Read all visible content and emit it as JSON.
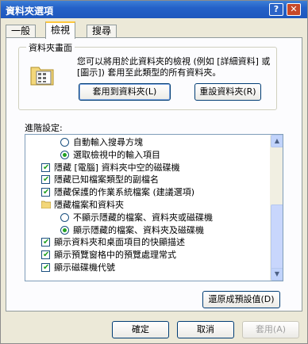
{
  "window": {
    "title": "資料夾選項"
  },
  "tabs": [
    {
      "label": "一般",
      "active": false
    },
    {
      "label": "檢視",
      "active": true
    },
    {
      "label": "搜尋",
      "active": false
    }
  ],
  "folder_views": {
    "group_title": "資料夾畫面",
    "description": "您可以將用於此資料夾的檢視 (例如 [詳細資料] 或 [圖示]) 套用至此類型的所有資料夾。",
    "apply_button": "套用到資料夾(L)",
    "reset_button": "重設資料夾(R)"
  },
  "advanced": {
    "label": "進階設定:",
    "items": [
      {
        "type": "radio",
        "checked": false,
        "level": 1,
        "label": "自動輸入搜尋方塊"
      },
      {
        "type": "radio",
        "checked": true,
        "level": 1,
        "label": "選取檢視中的輸入項目"
      },
      {
        "type": "checkbox",
        "checked": true,
        "level": 0,
        "label": "隱藏 [電腦] 資料夾中空的磁碟機"
      },
      {
        "type": "checkbox",
        "checked": true,
        "level": 0,
        "label": "隱藏已知檔案類型的副檔名"
      },
      {
        "type": "checkbox",
        "checked": true,
        "level": 0,
        "label": "隱藏保護的作業系統檔案 (建議選項)"
      },
      {
        "type": "folder",
        "checked": false,
        "level": 0,
        "label": "隱藏檔案和資料夾"
      },
      {
        "type": "radio",
        "checked": false,
        "level": 1,
        "label": "不顯示隱藏的檔案、資料夾或磁碟機"
      },
      {
        "type": "radio",
        "checked": true,
        "level": 1,
        "label": "顯示隱藏的檔案、資料夾及磁碟機"
      },
      {
        "type": "checkbox",
        "checked": true,
        "level": 0,
        "label": "顯示資料夾和桌面項目的快顯描述"
      },
      {
        "type": "checkbox",
        "checked": true,
        "level": 0,
        "label": "顯示預覽窗格中的預覽處理常式"
      },
      {
        "type": "checkbox",
        "checked": true,
        "level": 0,
        "label": "顯示磁碟機代號"
      }
    ],
    "restore_button": "還原成預設值(D)"
  },
  "footer": {
    "ok": "確定",
    "cancel": "取消",
    "apply": "套用(A)"
  },
  "icons": {
    "help": "help-icon",
    "close": "close-icon"
  },
  "colors": {
    "titlebar": "#2461c8",
    "accent_tab": "#ffc83c",
    "check": "#21a121"
  }
}
